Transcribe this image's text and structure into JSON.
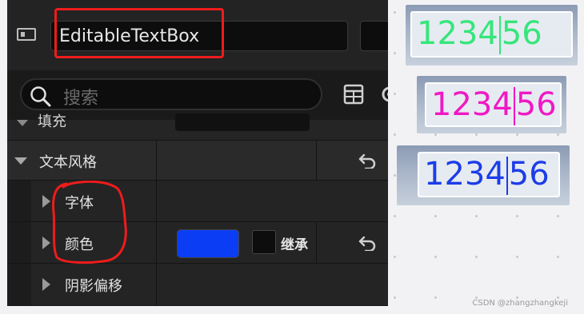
{
  "header": {
    "widget_name": "EditableTextBox"
  },
  "search": {
    "placeholder": "搜索"
  },
  "partial_row": {
    "label": "填充"
  },
  "sections": {
    "text_style": {
      "label": "文本风格"
    },
    "font": {
      "label": "字体"
    },
    "color": {
      "label": "颜色",
      "swatch_color": "#0b3df5",
      "inherit_label": "继承"
    },
    "shadow_offset": {
      "label": "阴影偏移"
    }
  },
  "previews": [
    {
      "before": "1234",
      "after": "56",
      "color": "#35e67a"
    },
    {
      "before": "1234",
      "after": "56",
      "color": "#f018c4"
    },
    {
      "before": "1234",
      "after": "56",
      "color": "#1c3de8"
    }
  ],
  "watermark": "CSDN @zhangzhangkeji"
}
